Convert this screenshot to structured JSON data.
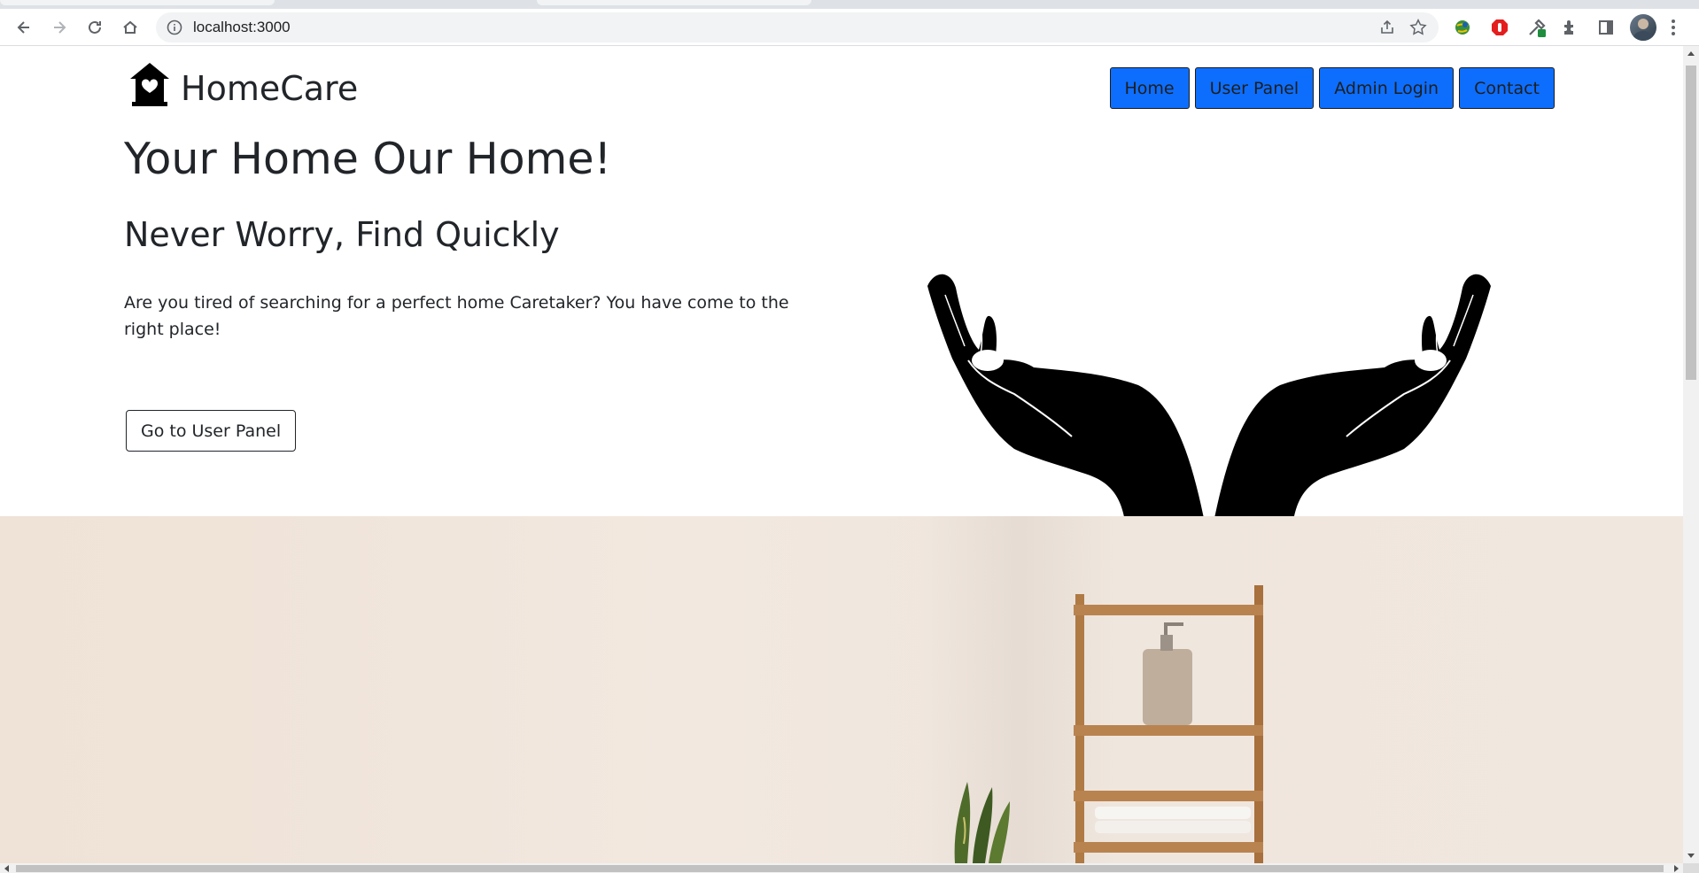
{
  "browser": {
    "url": "localhost:3000"
  },
  "site": {
    "brand": "HomeCare",
    "nav": [
      {
        "label": "Home"
      },
      {
        "label": "User Panel"
      },
      {
        "label": "Admin Login"
      },
      {
        "label": "Contact"
      }
    ]
  },
  "hero": {
    "title": "Your Home Our Home!",
    "subtitle": "Never Worry, Find Quickly",
    "description": "Are you tired of searching for a perfect home Caretaker? You have come to the right place!",
    "cta_label": "Go to User Panel"
  },
  "colors": {
    "nav_button": "#0d6efd",
    "text": "#212529",
    "photo_bg": "#f0e6dd"
  },
  "icons": [
    "back-icon",
    "forward-icon",
    "reload-icon",
    "home-icon",
    "info-icon",
    "share-icon",
    "star-icon",
    "extensions-icon",
    "side-panel-icon",
    "house-heart-icon",
    "caring-hands-icon"
  ]
}
